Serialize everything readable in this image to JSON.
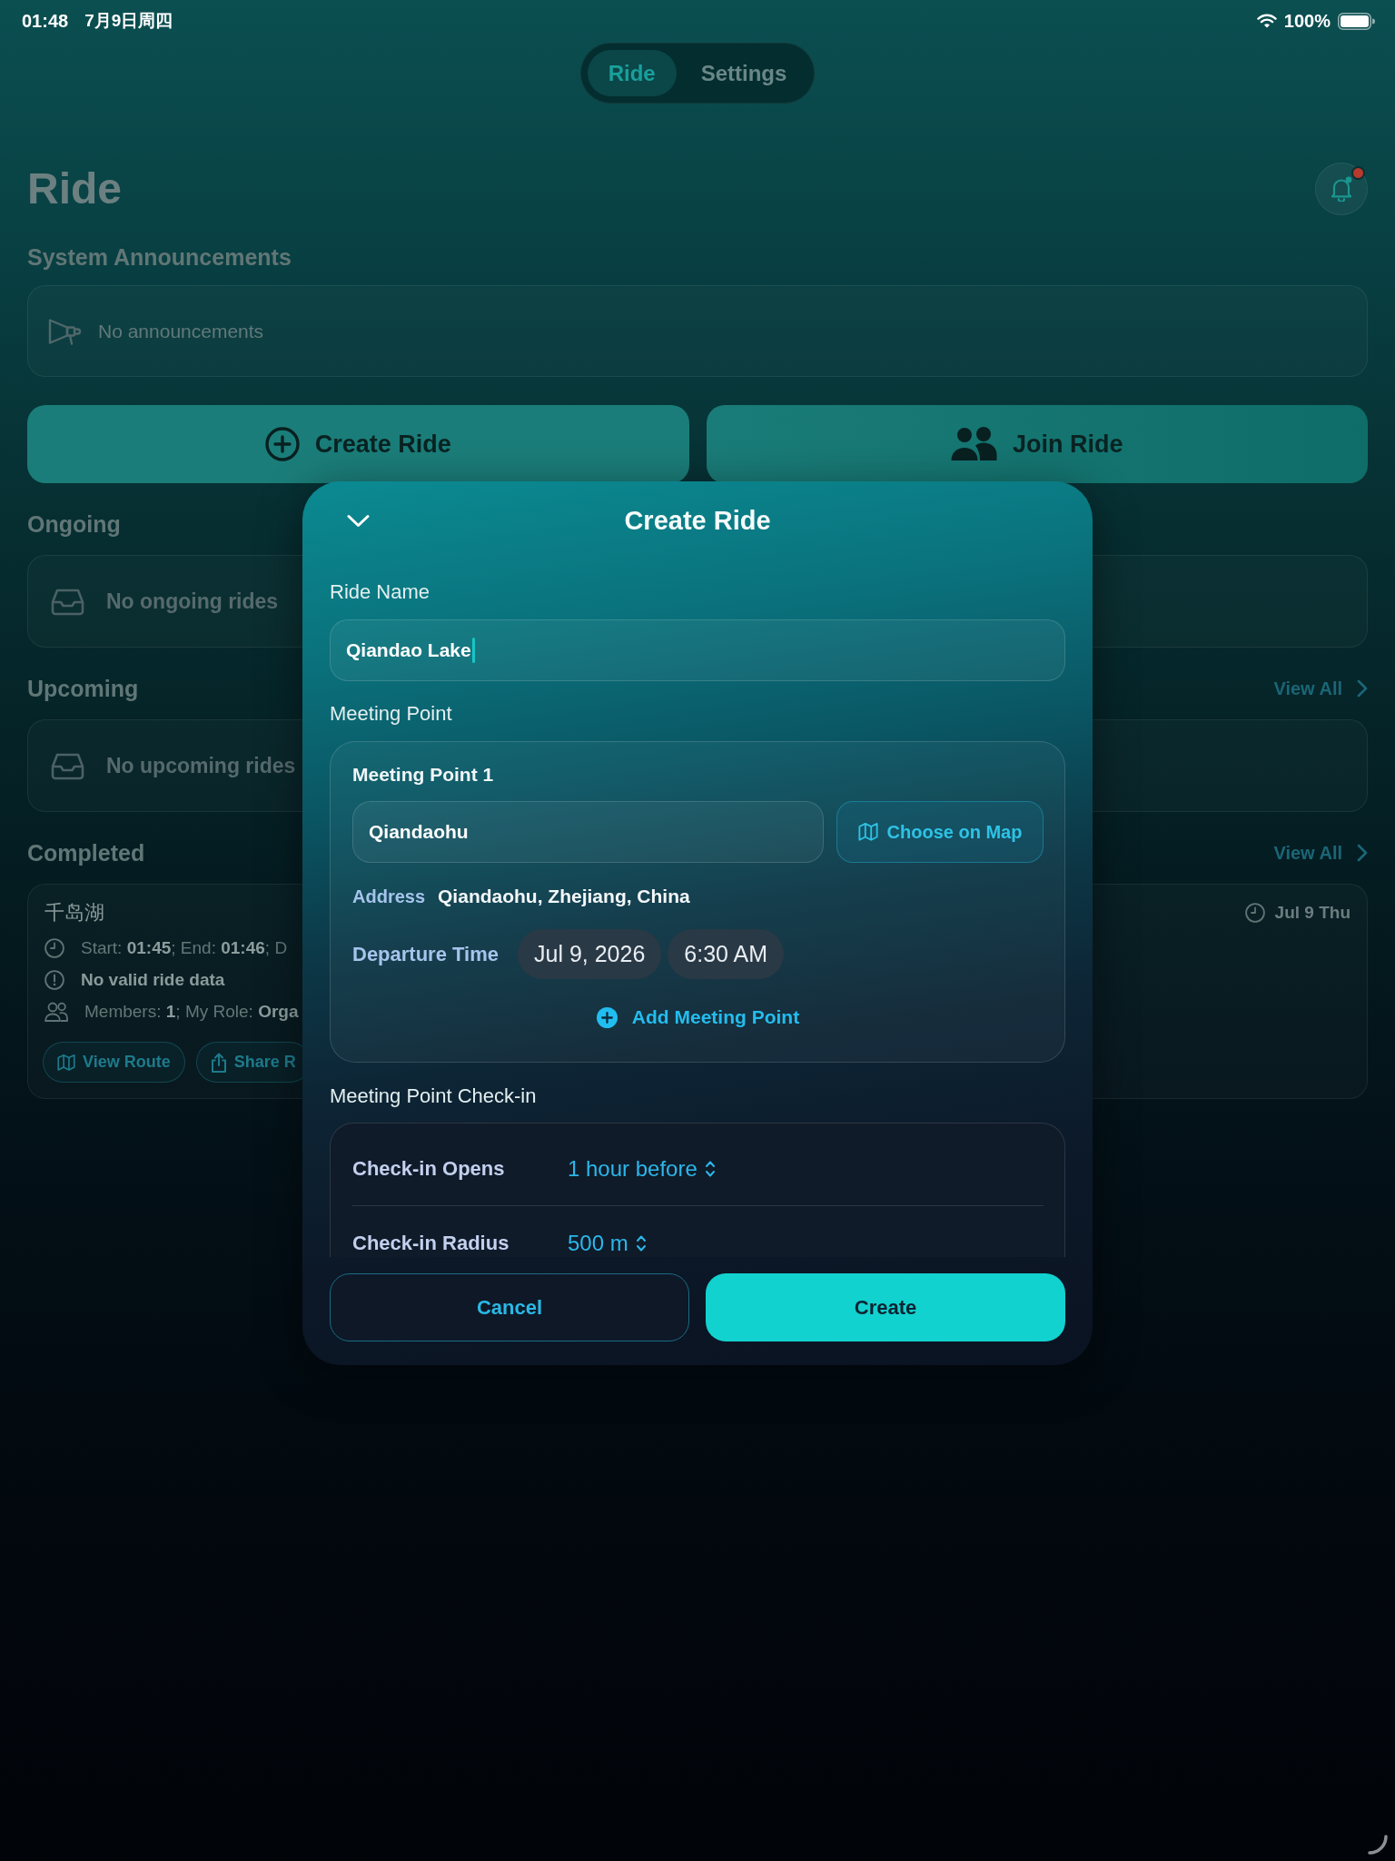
{
  "status_bar": {
    "time": "01:48",
    "date": "7月9日周四",
    "battery": "100%"
  },
  "tabs": [
    {
      "label": "Ride",
      "selected": true
    },
    {
      "label": "Settings",
      "selected": false
    }
  ],
  "header": {
    "title": "Ride",
    "unread_notifications": true
  },
  "announcements": {
    "heading": "System Announcements",
    "empty_text": "No announcements"
  },
  "actions": [
    {
      "kind": "create",
      "label": "Create Ride"
    },
    {
      "kind": "join",
      "label": "Join Ride"
    }
  ],
  "sections": [
    {
      "heading": "Ongoing",
      "empty_text": "No ongoing rides"
    },
    {
      "heading": "Upcoming",
      "link": "View All",
      "empty_text": "No upcoming rides"
    },
    {
      "heading": "Completed",
      "link": "View All",
      "rides": [
        {
          "name": "千岛湖",
          "date": "Jul 9 Thu",
          "details": [
            {
              "kind": "time",
              "text": "Start: **01:45**; End: **01:46**; D"
            },
            {
              "kind": "warning",
              "text": "No valid ride data"
            },
            {
              "kind": "members",
              "text": "Members: **1**; My Role: **Orga**"
            }
          ],
          "buttons": [
            {
              "kind": "route",
              "label": "View Route"
            },
            {
              "kind": "share",
              "label": "Share R"
            }
          ]
        }
      ]
    }
  ],
  "modal": {
    "title": "Create Ride",
    "ride_name": {
      "label": "Ride Name",
      "value": "Qiandao Lake",
      "focused": true
    },
    "meeting_point": {
      "label": "Meeting Point",
      "points": [
        {
          "title": "Meeting Point 1",
          "value": "Qiandaohu",
          "map_button": "Choose on Map",
          "address_label": "Address",
          "address": "Qiandaohu, Zhejiang, China",
          "departure_label": "Departure Time",
          "date": "Jul 9, 2026",
          "time": "6:30 AM"
        }
      ],
      "add_button": "Add Meeting Point"
    },
    "check_in": {
      "label": "Meeting Point Check-in",
      "rows": [
        {
          "label": "Check-in Opens",
          "value": "1 hour before"
        },
        {
          "label": "Check-in Radius",
          "value": "500 m"
        }
      ]
    },
    "buttons": [
      {
        "kind": "cancel",
        "label": "Cancel"
      },
      {
        "kind": "create",
        "label": "Create"
      }
    ]
  }
}
